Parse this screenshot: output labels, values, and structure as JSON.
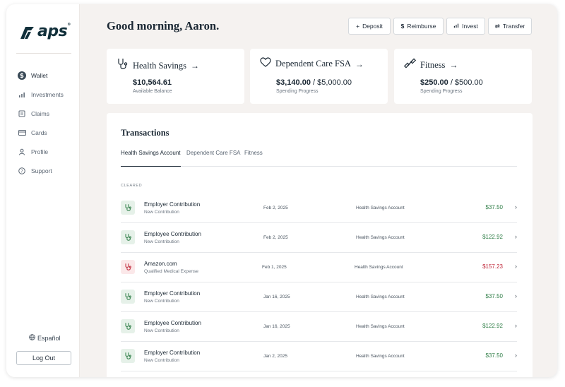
{
  "brand": {
    "name": "aps",
    "mark": "®"
  },
  "sidebar": {
    "items": [
      {
        "label": "Wallet",
        "icon": "dollar-icon",
        "active": true
      },
      {
        "label": "Investments",
        "icon": "bar-chart-icon",
        "active": false
      },
      {
        "label": "Claims",
        "icon": "document-icon",
        "active": false
      },
      {
        "label": "Cards",
        "icon": "card-icon",
        "active": false
      },
      {
        "label": "Profile",
        "icon": "user-icon",
        "active": false
      },
      {
        "label": "Support",
        "icon": "help-icon",
        "active": false
      }
    ],
    "language": "Español",
    "logout": "Log Out"
  },
  "header": {
    "greeting": "Good morning, Aaron.",
    "actions": {
      "deposit": "Deposit",
      "reimburse": "Reimburse",
      "invest": "Invest",
      "transfer": "Transfer"
    }
  },
  "cards": {
    "hsa": {
      "title": "Health Savings",
      "value": "$10,564.61",
      "sub": "Available Balance"
    },
    "fsa": {
      "title": "Dependent Care FSA",
      "value": "$3,140.00",
      "limit": " / $5,000.00",
      "sub": "Spending Progress"
    },
    "fitness": {
      "title": "Fitness",
      "value": "$250.00",
      "limit": " / $500.00",
      "sub": "Spending Progress"
    }
  },
  "transactions": {
    "title": "Transactions",
    "tabs": [
      "Health Savings Account",
      "Dependent Care FSA",
      "Fitness"
    ],
    "section": "CLEARED",
    "rows": [
      {
        "name": "Employer Contribution",
        "sub": "New Contribution",
        "date": "Feb 2, 2025",
        "account": "Health Savings Account",
        "amount": "$37.50",
        "negative": false
      },
      {
        "name": "Employee Contribution",
        "sub": "New Contribution",
        "date": "Feb 2, 2025",
        "account": "Health Savings Account",
        "amount": "$122.92",
        "negative": false
      },
      {
        "name": "Amazon.com",
        "sub": "Qualified Medical Expense",
        "date": "Feb 1, 2025",
        "account": "Health Savings Account",
        "amount": "$157.23",
        "negative": true
      },
      {
        "name": "Employer Contribution",
        "sub": "New Contribution",
        "date": "Jan 16, 2025",
        "account": "Health Savings Account",
        "amount": "$37.50",
        "negative": false
      },
      {
        "name": "Employee Contribution",
        "sub": "New Contribution",
        "date": "Jan 16, 2025",
        "account": "Health Savings Account",
        "amount": "$122.92",
        "negative": false
      },
      {
        "name": "Employer Contribution",
        "sub": "New Contribution",
        "date": "Jan 2, 2025",
        "account": "Health Savings Account",
        "amount": "$37.50",
        "negative": false
      }
    ]
  },
  "colors": {
    "brand": "#12303b",
    "positive": "#2e7d46",
    "negative": "#c0283a",
    "background": "#f5f2f0"
  }
}
